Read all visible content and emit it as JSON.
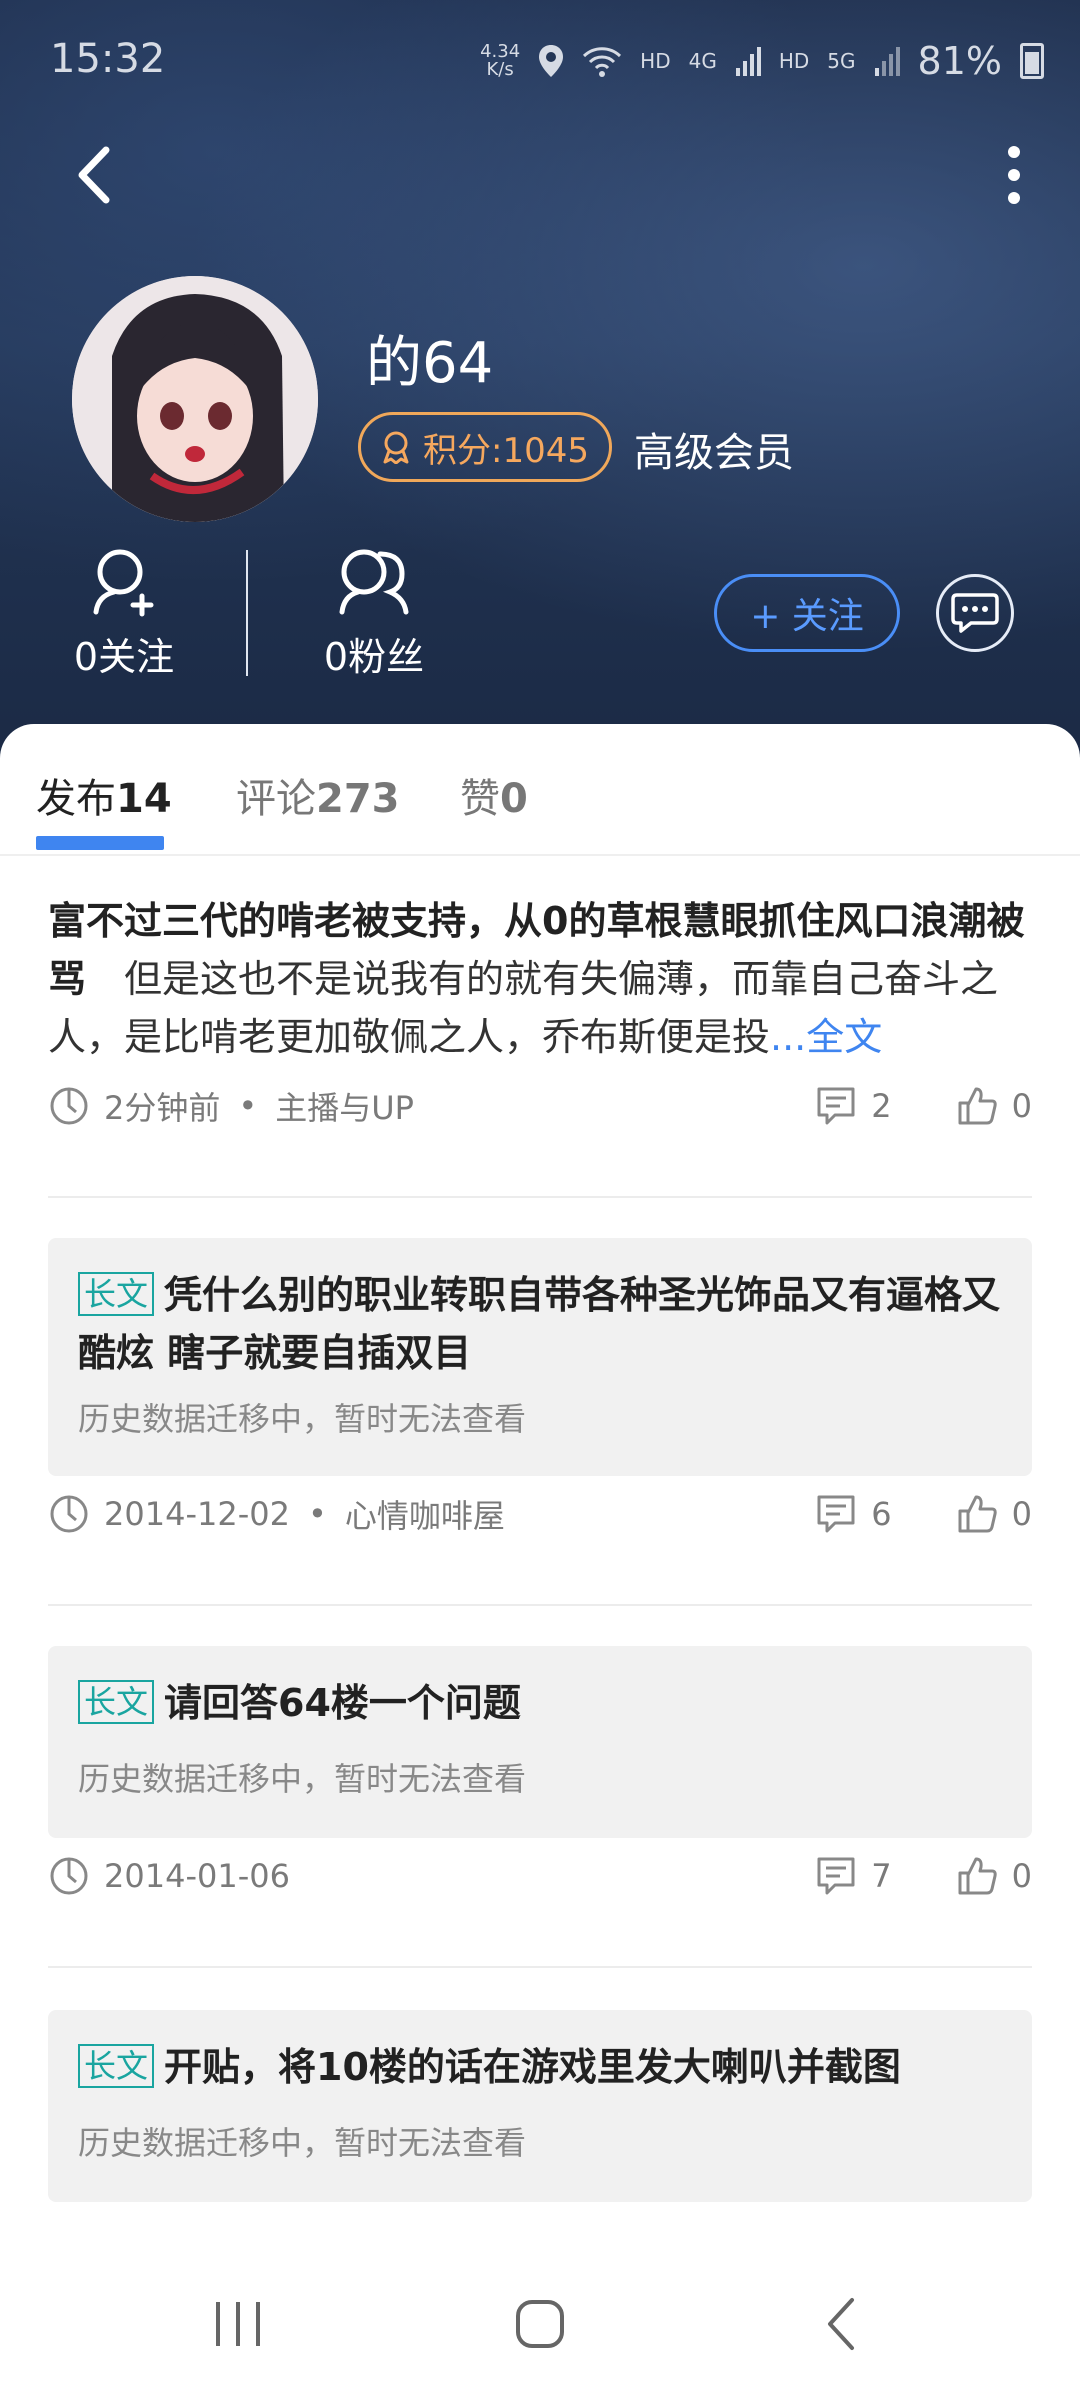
{
  "status_bar": {
    "time": "15:32",
    "net_speed_value": "4.34",
    "net_speed_unit": "K/s",
    "hd1": "HD",
    "net1": "4G",
    "hd2": "HD",
    "net2": "5G",
    "battery": "81%"
  },
  "profile": {
    "username": "的64",
    "points_label": "积分:1045",
    "member_level": "高级会员",
    "following": "0关注",
    "followers": "0粉丝",
    "follow_button": "+ 关注"
  },
  "tabs": [
    {
      "label": "发布",
      "count": "14"
    },
    {
      "label": "评论",
      "count": "273"
    },
    {
      "label": "赞",
      "count": "0"
    }
  ],
  "posts": [
    {
      "title": "富不过三代的啃老被支持，从0的草根慧眼抓住风口浪潮被骂",
      "body": "　但是这也不是说我有的就有失偏薄，而靠自己奋斗之人，是比啃老更加敬佩之人，乔布斯便是投",
      "more": "...全文",
      "time": "2分钟前",
      "category": "主播与UP",
      "comments": "2",
      "likes": "0"
    },
    {
      "tag": "长文",
      "title": "凭什么别的职业转职自带各种圣光饰品又有逼格又酷炫 瞎子就要自插双目",
      "subtitle": "历史数据迁移中，暂时无法查看",
      "time": "2014-12-02",
      "category": "心情咖啡屋",
      "comments": "6",
      "likes": "0"
    },
    {
      "tag": "长文",
      "title": "请回答64楼一个问题",
      "subtitle": "历史数据迁移中，暂时无法查看",
      "time": "2014-01-06",
      "comments": "7",
      "likes": "0"
    },
    {
      "tag": "长文",
      "title": "开贴，将10楼的话在游戏里发大喇叭并截图",
      "subtitle": "历史数据迁移中，暂时无法查看"
    }
  ],
  "colors": {
    "accent": "#3f85f0",
    "tag": "#1aa5a0",
    "points": "#f6a85e"
  },
  "icons": [
    "back-arrow-icon",
    "more-vertical-icon",
    "add-user-icon",
    "fans-icon",
    "chat-icon",
    "clock-icon",
    "comment-icon",
    "thumb-up-icon"
  ]
}
